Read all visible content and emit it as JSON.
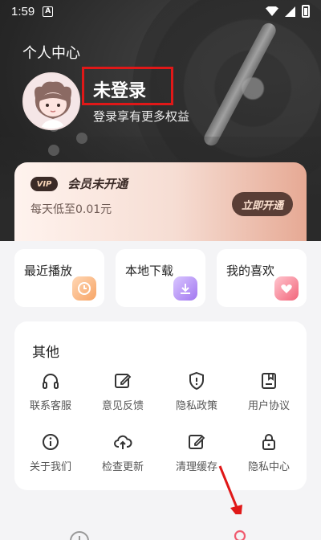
{
  "status_bar": {
    "time": "1:59",
    "notification_glyph": "A"
  },
  "header": {
    "title": "个人中心",
    "username": "未登录",
    "subtitle": "登录享有更多权益"
  },
  "vip": {
    "badge": "VIP",
    "title": "会员未开通",
    "desc": "每天低至0.01元",
    "button": "立即开通"
  },
  "quick_actions": [
    {
      "label": "最近播放",
      "icon": "clock-icon",
      "color": "#f7a465"
    },
    {
      "label": "本地下载",
      "icon": "download-icon",
      "color": "#a277f0"
    },
    {
      "label": "我的喜欢",
      "icon": "heart-icon",
      "color": "#f2657a"
    }
  ],
  "others": {
    "title": "其他",
    "items": [
      {
        "label": "联系客服",
        "icon": "headphones-icon"
      },
      {
        "label": "意见反馈",
        "icon": "edit-icon"
      },
      {
        "label": "隐私政策",
        "icon": "shield-icon"
      },
      {
        "label": "用户协议",
        "icon": "bookmark-doc-icon"
      },
      {
        "label": "关于我们",
        "icon": "info-icon"
      },
      {
        "label": "检查更新",
        "icon": "cloud-upload-icon"
      },
      {
        "label": "清理缓存",
        "icon": "edit-icon"
      },
      {
        "label": "隐私中心",
        "icon": "lock-icon"
      }
    ]
  },
  "colors": {
    "highlight_box": "#e01818",
    "arrow": "#e01818",
    "icon_stroke": "#333333"
  }
}
